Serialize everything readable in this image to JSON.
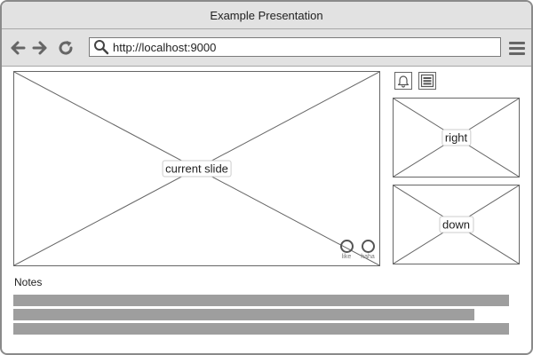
{
  "window": {
    "title": "Example Presentation"
  },
  "browser": {
    "url": "http://localhost:9000",
    "icons": [
      "back-arrow-icon",
      "forward-arrow-icon",
      "reload-icon",
      "search-icon",
      "hamburger-menu-icon"
    ]
  },
  "slides": {
    "current_label": "current slide",
    "right_label": "right",
    "down_label": "down"
  },
  "reactions": [
    {
      "label": "like"
    },
    {
      "label": "haha"
    }
  ],
  "sidebar": {
    "icons": [
      "bell-icon",
      "overview-icon"
    ]
  },
  "notes": {
    "title": "Notes",
    "line_fill": [
      1.0,
      0.93,
      1.0
    ]
  },
  "colors": {
    "chrome": "#e2e2e2",
    "border": "#666666",
    "notes_bar": "#9e9e9e"
  }
}
